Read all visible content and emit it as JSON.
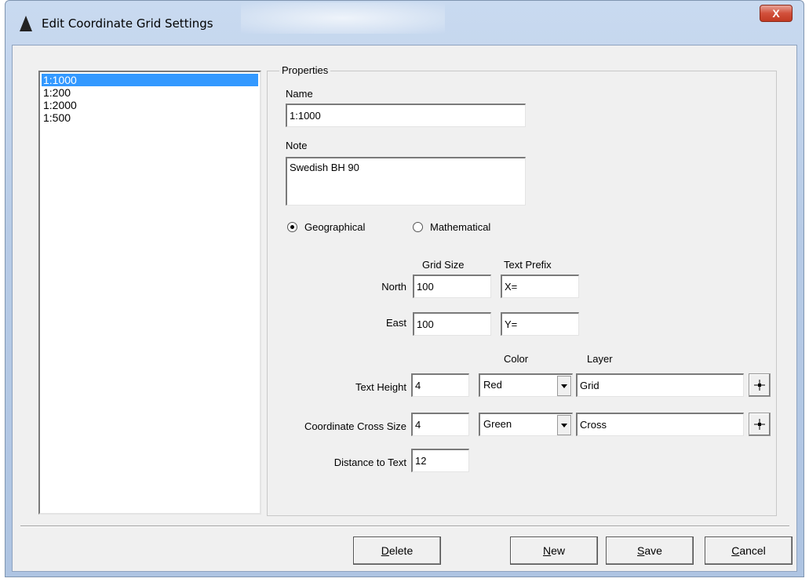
{
  "window": {
    "title": "Edit Coordinate Grid Settings",
    "close_label": "X"
  },
  "list": {
    "items": [
      "1:1000",
      "1:200",
      "1:2000",
      "1:500"
    ],
    "selected_index": 0
  },
  "properties": {
    "group_title": "Properties",
    "name_label": "Name",
    "name_value": "1:1000",
    "note_label": "Note",
    "note_value": "Swedish BH 90",
    "radio_geographical": "Geographical",
    "radio_mathematical": "Mathematical",
    "selected_mode": "Geographical",
    "grid_size_header": "Grid Size",
    "text_prefix_header": "Text Prefix",
    "north_label": "North",
    "north_grid_size": "100",
    "north_prefix": "X=",
    "east_label": "East",
    "east_grid_size": "100",
    "east_prefix": "Y=",
    "color_header": "Color",
    "layer_header": "Layer",
    "text_height_label": "Text Height",
    "text_height_value": "4",
    "text_height_color": "Red",
    "text_height_layer": "Grid",
    "cross_size_label": "Coordinate Cross Size",
    "cross_size_value": "4",
    "cross_color": "Green",
    "cross_layer": "Cross",
    "distance_label": "Distance to Text",
    "distance_value": "12"
  },
  "buttons": {
    "delete_first": "D",
    "delete_rest": "elete",
    "new_first": "N",
    "new_rest": "ew",
    "save_first": "S",
    "save_rest": "ave",
    "cancel_first": "C",
    "cancel_rest": "ancel"
  },
  "icons": {
    "app": "warning-triangle-icon",
    "pick": "crosshair-icon"
  }
}
